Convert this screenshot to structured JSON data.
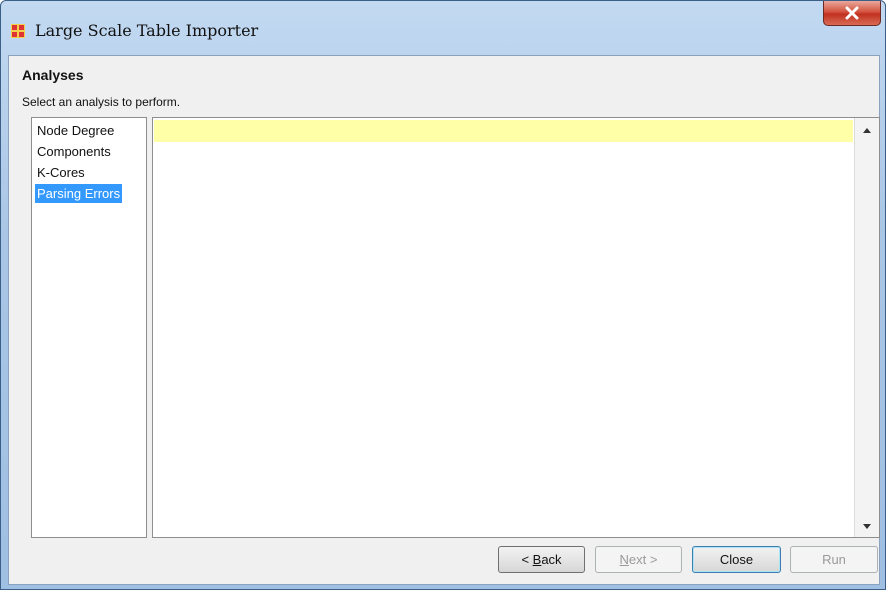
{
  "window": {
    "title": "Large Scale Table Importer",
    "close_glyph": "X",
    "accent": "#3399ff"
  },
  "header": {
    "title": "Analyses",
    "subtitle": "Select an analysis to perform."
  },
  "analyses": {
    "items": [
      {
        "label": "Node Degree",
        "selected": false
      },
      {
        "label": "Components",
        "selected": false
      },
      {
        "label": "K-Cores",
        "selected": false
      },
      {
        "label": "Parsing Errors",
        "selected": true
      }
    ]
  },
  "buttons": {
    "back": {
      "prefix": "< ",
      "mnemonic": "B",
      "rest": "ack",
      "enabled": true
    },
    "next": {
      "mnemonic": "N",
      "rest": "ext >",
      "enabled": false
    },
    "close": {
      "label": "Close",
      "enabled": true
    },
    "run": {
      "label": "Run",
      "enabled": false
    }
  },
  "icons": {
    "app": "network-grid-icon",
    "close": "close-x-icon",
    "scroll_up": "arrow-up-icon",
    "scroll_down": "arrow-down-icon"
  }
}
